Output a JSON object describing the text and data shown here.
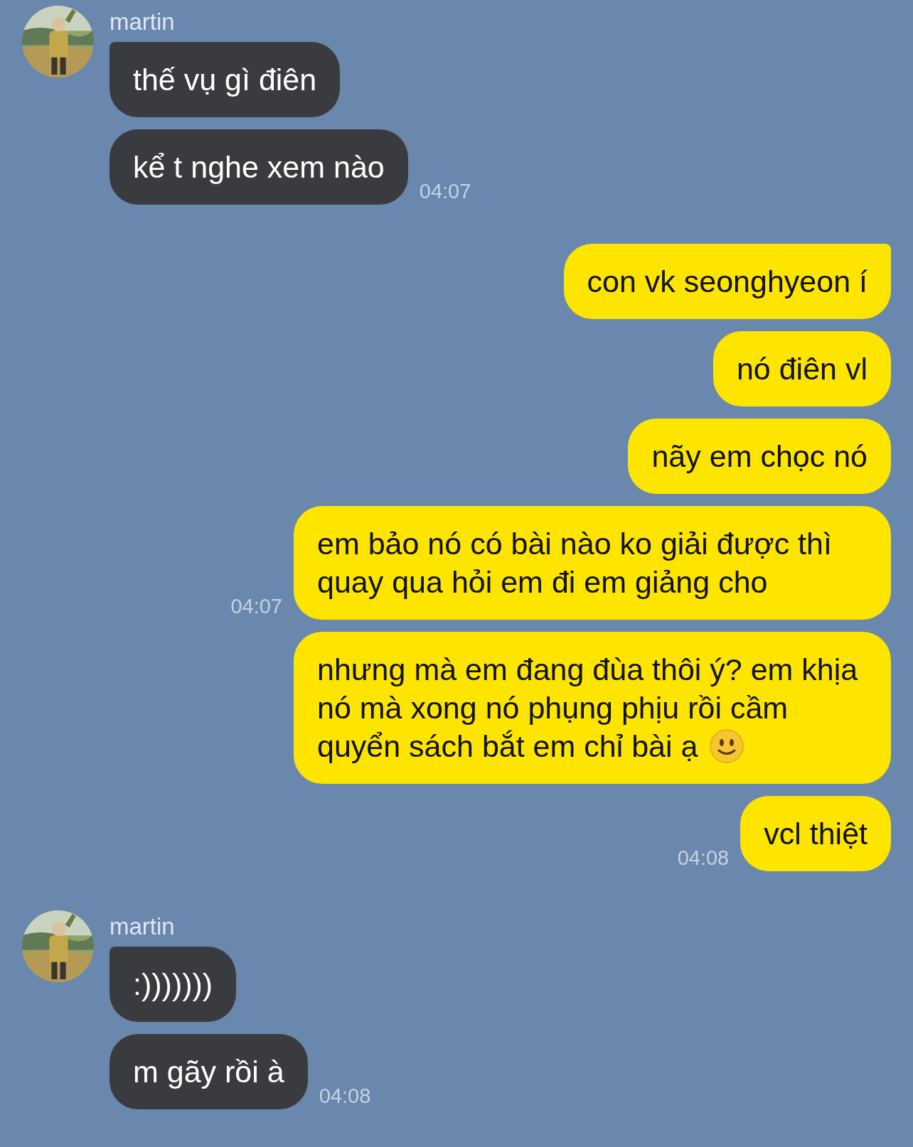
{
  "groups": [
    {
      "kind": "incoming",
      "sender": "martin",
      "messages": [
        {
          "text": "thế vụ gì điên"
        },
        {
          "text": "kể t nghe xem nào",
          "time": "04:07"
        }
      ]
    },
    {
      "kind": "outgoing",
      "messages": [
        {
          "text": "con vk seonghyeon í"
        },
        {
          "text": "nó điên vl"
        },
        {
          "text": "nãy em chọc nó"
        },
        {
          "text": "em bảo nó có bài nào ko giải được thì quay qua hỏi em đi em giảng cho",
          "time": "04:07"
        },
        {
          "text": "nhưng mà em đang đùa thôi ý? em khịa nó mà xong nó phụng phịu rồi cầm quyển sách bắt em chỉ bài ạ",
          "kind": "with-smiley"
        },
        {
          "text": "vcl thiệt",
          "time": "04:08"
        }
      ]
    },
    {
      "kind": "incoming",
      "sender": "martin",
      "messages": [
        {
          "text": ":)))))))"
        },
        {
          "text": "m gãy rồi à",
          "time": "04:08"
        }
      ]
    }
  ]
}
